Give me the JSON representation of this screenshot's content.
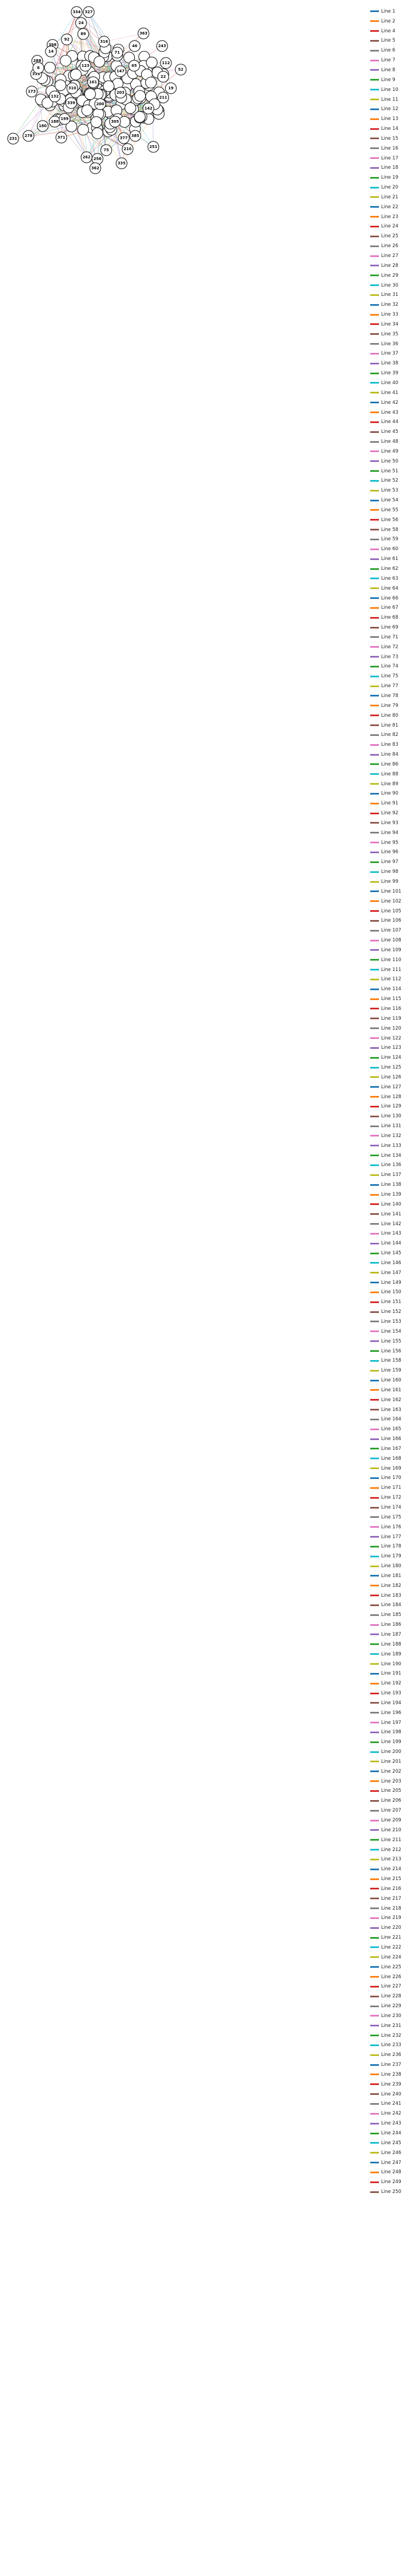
{
  "diagram": {
    "node_labels": [
      "334",
      "327",
      "24",
      "92",
      "398",
      "89",
      "316",
      "363",
      "243",
      "46",
      "52",
      "112",
      "22",
      "19",
      "288",
      "311",
      "173",
      "211",
      "188",
      "231",
      "278",
      "180",
      "371",
      "75",
      "335",
      "251",
      "262",
      "256",
      "362",
      "203",
      "210",
      "142",
      "14",
      "6",
      "310",
      "199",
      "147",
      "200",
      "385",
      "339",
      "71",
      "132",
      "65",
      "305",
      "123",
      "377",
      "101"
    ],
    "line_colors": [
      "#1f77b4",
      "#ff7f0e",
      "#d62728",
      "#8c564b",
      "#7f7f7f",
      "#e377c2",
      "#9467bd",
      "#2ca02c",
      "#17becf",
      "#bcbd22"
    ]
  },
  "legend": {
    "entries": [
      "Line 1",
      "Line 2",
      "Line 4",
      "Line 5",
      "Line 6",
      "Line 7",
      "Line 8",
      "Line 9",
      "Line 10",
      "Line 11",
      "Line 12",
      "Line 13",
      "Line 14",
      "Line 15",
      "Line 16",
      "Line 17",
      "Line 18",
      "Line 19",
      "Line 20",
      "Line 21",
      "Line 22",
      "Line 23",
      "Line 24",
      "Line 25",
      "Line 26",
      "Line 27",
      "Line 28",
      "Line 29",
      "Line 30",
      "Line 31",
      "Line 32",
      "Line 33",
      "Line 34",
      "Line 35",
      "Line 36",
      "Line 37",
      "Line 38",
      "Line 39",
      "Line 40",
      "Line 41",
      "Line 42",
      "Line 43",
      "Line 44",
      "Line 45",
      "Line 48",
      "Line 49",
      "Line 50",
      "Line 51",
      "Line 52",
      "Line 53",
      "Line 54",
      "Line 55",
      "Line 56",
      "Line 58",
      "Line 59",
      "Line 60",
      "Line 61",
      "Line 62",
      "Line 63",
      "Line 64",
      "Line 66",
      "Line 67",
      "Line 68",
      "Line 69",
      "Line 71",
      "Line 72",
      "Line 73",
      "Line 74",
      "Line 75",
      "Line 77",
      "Line 78",
      "Line 79",
      "Line 80",
      "Line 81",
      "Line 82",
      "Line 83",
      "Line 84",
      "Line 86",
      "Line 88",
      "Line 89",
      "Line 90",
      "Line 91",
      "Line 92",
      "Line 93",
      "Line 94",
      "Line 95",
      "Line 96",
      "Line 97",
      "Line 98",
      "Line 99",
      "Line 101",
      "Line 102",
      "Line 105",
      "Line 106",
      "Line 107",
      "Line 108",
      "Line 109",
      "Line 110",
      "Line 111",
      "Line 112",
      "Line 114",
      "Line 115",
      "Line 116",
      "Line 119",
      "Line 120",
      "Line 122",
      "Line 123",
      "Line 124",
      "Line 125",
      "Line 126",
      "Line 127",
      "Line 128",
      "Line 129",
      "Line 130",
      "Line 131",
      "Line 132",
      "Line 133",
      "Line 134",
      "Line 136",
      "Line 137",
      "Line 138",
      "Line 139",
      "Line 140",
      "Line 141",
      "Line 142",
      "Line 143",
      "Line 144",
      "Line 145",
      "Line 146",
      "Line 147",
      "Line 149",
      "Line 150",
      "Line 151",
      "Line 152",
      "Line 153",
      "Line 154",
      "Line 155",
      "Line 156",
      "Line 158",
      "Line 159",
      "Line 160",
      "Line 161",
      "Line 162",
      "Line 163",
      "Line 164",
      "Line 165",
      "Line 166",
      "Line 167",
      "Line 168",
      "Line 169",
      "Line 170",
      "Line 171",
      "Line 172",
      "Line 174",
      "Line 175",
      "Line 176",
      "Line 177",
      "Line 178",
      "Line 179",
      "Line 180",
      "Line 181",
      "Line 182",
      "Line 183",
      "Line 184",
      "Line 185",
      "Line 186",
      "Line 187",
      "Line 188",
      "Line 189",
      "Line 190",
      "Line 191",
      "Line 192",
      "Line 193",
      "Line 194",
      "Line 196",
      "Line 197",
      "Line 198",
      "Line 199",
      "Line 200",
      "Line 201",
      "Line 202",
      "Line 203",
      "Line 205",
      "Line 206",
      "Line 207",
      "Line 209",
      "Line 210",
      "Line 211",
      "Line 212",
      "Line 213",
      "Line 214",
      "Line 215",
      "Line 216",
      "Line 217",
      "Line 218",
      "Line 219",
      "Line 220",
      "Line 221",
      "Line 222",
      "Line 224",
      "Line 225",
      "Line 226",
      "Line 227",
      "Line 228",
      "Line 229",
      "Line 230",
      "Line 231",
      "Line 232",
      "Line 233",
      "Line 236",
      "Line 237",
      "Line 238",
      "Line 239",
      "Line 240",
      "Line 241",
      "Line 242",
      "Line 243",
      "Line 244",
      "Line 245",
      "Line 246",
      "Line 247",
      "Line 248",
      "Line 249",
      "Line 250"
    ]
  }
}
